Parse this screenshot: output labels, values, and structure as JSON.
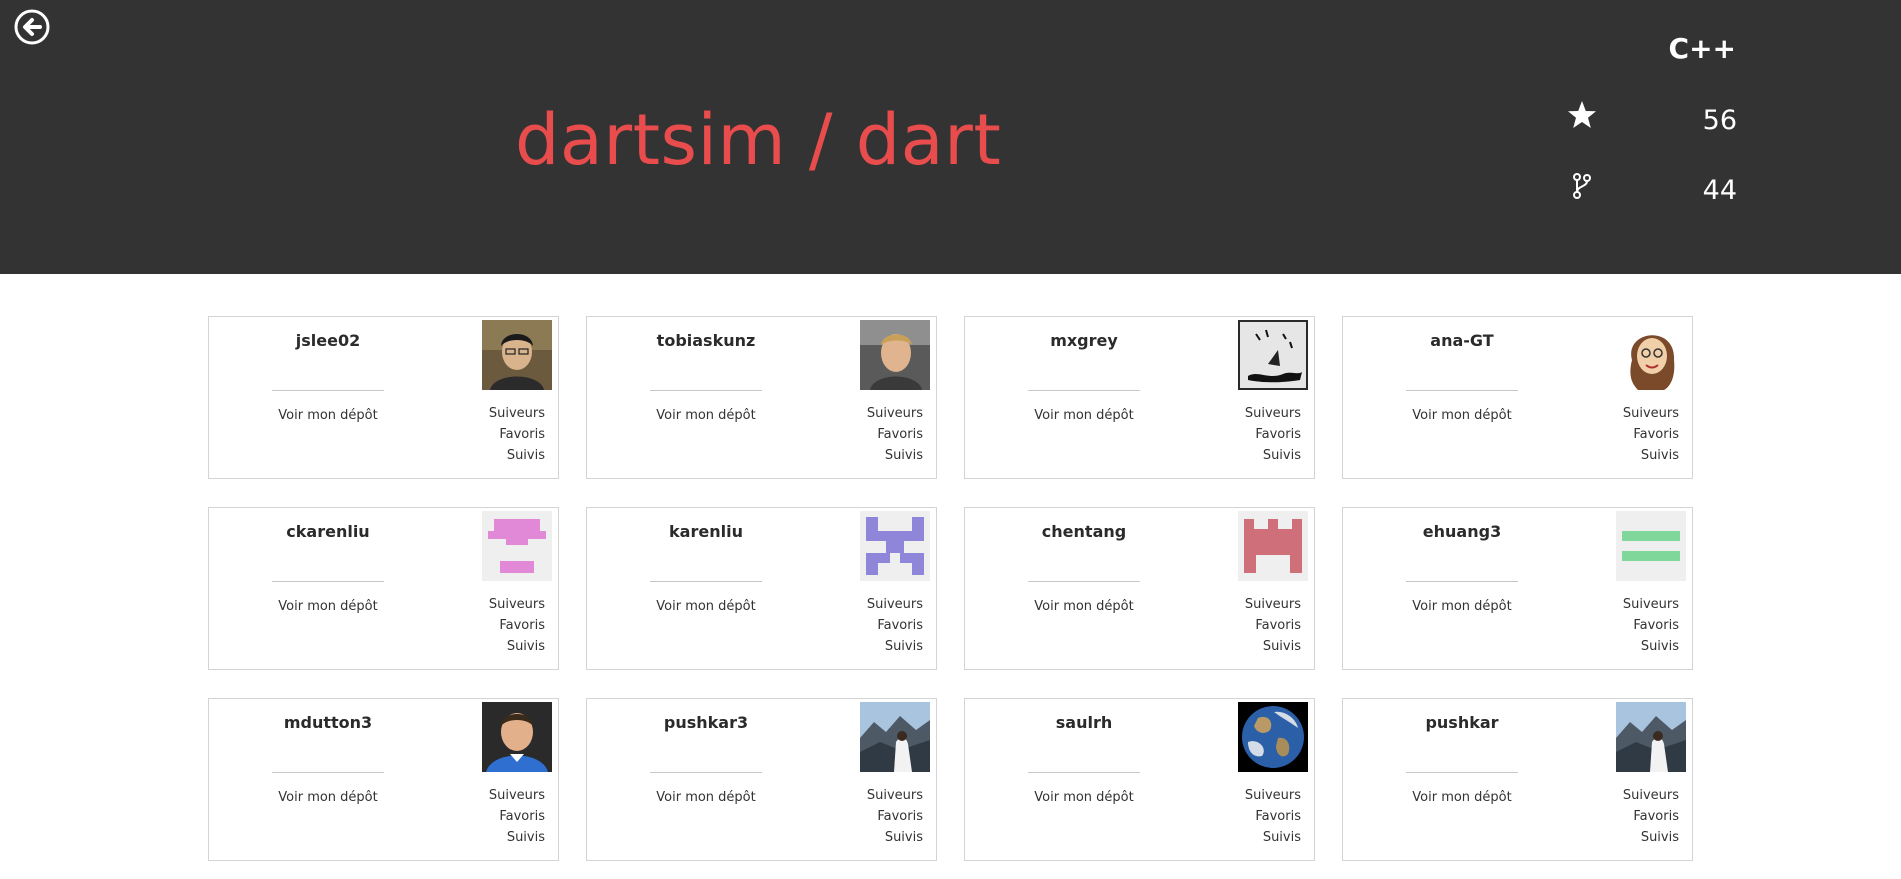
{
  "repo": {
    "title": "dartsim / dart",
    "language": "C++",
    "stars": "56",
    "forks": "44"
  },
  "labels": {
    "repo_link": "Voir mon dépôt",
    "followers": "Suiveurs",
    "favorites": "Favoris",
    "following": "Suivis"
  },
  "contributors": [
    {
      "username": "jslee02",
      "avatar": "photo-man-glasses"
    },
    {
      "username": "tobiaskunz",
      "avatar": "photo-man-blond"
    },
    {
      "username": "mxgrey",
      "avatar": "drawing-sketch"
    },
    {
      "username": "ana-GT",
      "avatar": "cartoon-woman"
    },
    {
      "username": "ckarenliu",
      "avatar": "identicon-pink"
    },
    {
      "username": "karenliu",
      "avatar": "identicon-purple"
    },
    {
      "username": "chentang",
      "avatar": "identicon-red"
    },
    {
      "username": "ehuang3",
      "avatar": "identicon-green"
    },
    {
      "username": "mdutton3",
      "avatar": "photo-man-blue-shirt"
    },
    {
      "username": "pushkar3",
      "avatar": "photo-mountain"
    },
    {
      "username": "saulrh",
      "avatar": "photo-earth"
    },
    {
      "username": "pushkar",
      "avatar": "photo-mountain"
    }
  ],
  "colors": {
    "header_bg": "#333333",
    "title": "#e84c4c",
    "card_border": "#d4d4d4"
  }
}
